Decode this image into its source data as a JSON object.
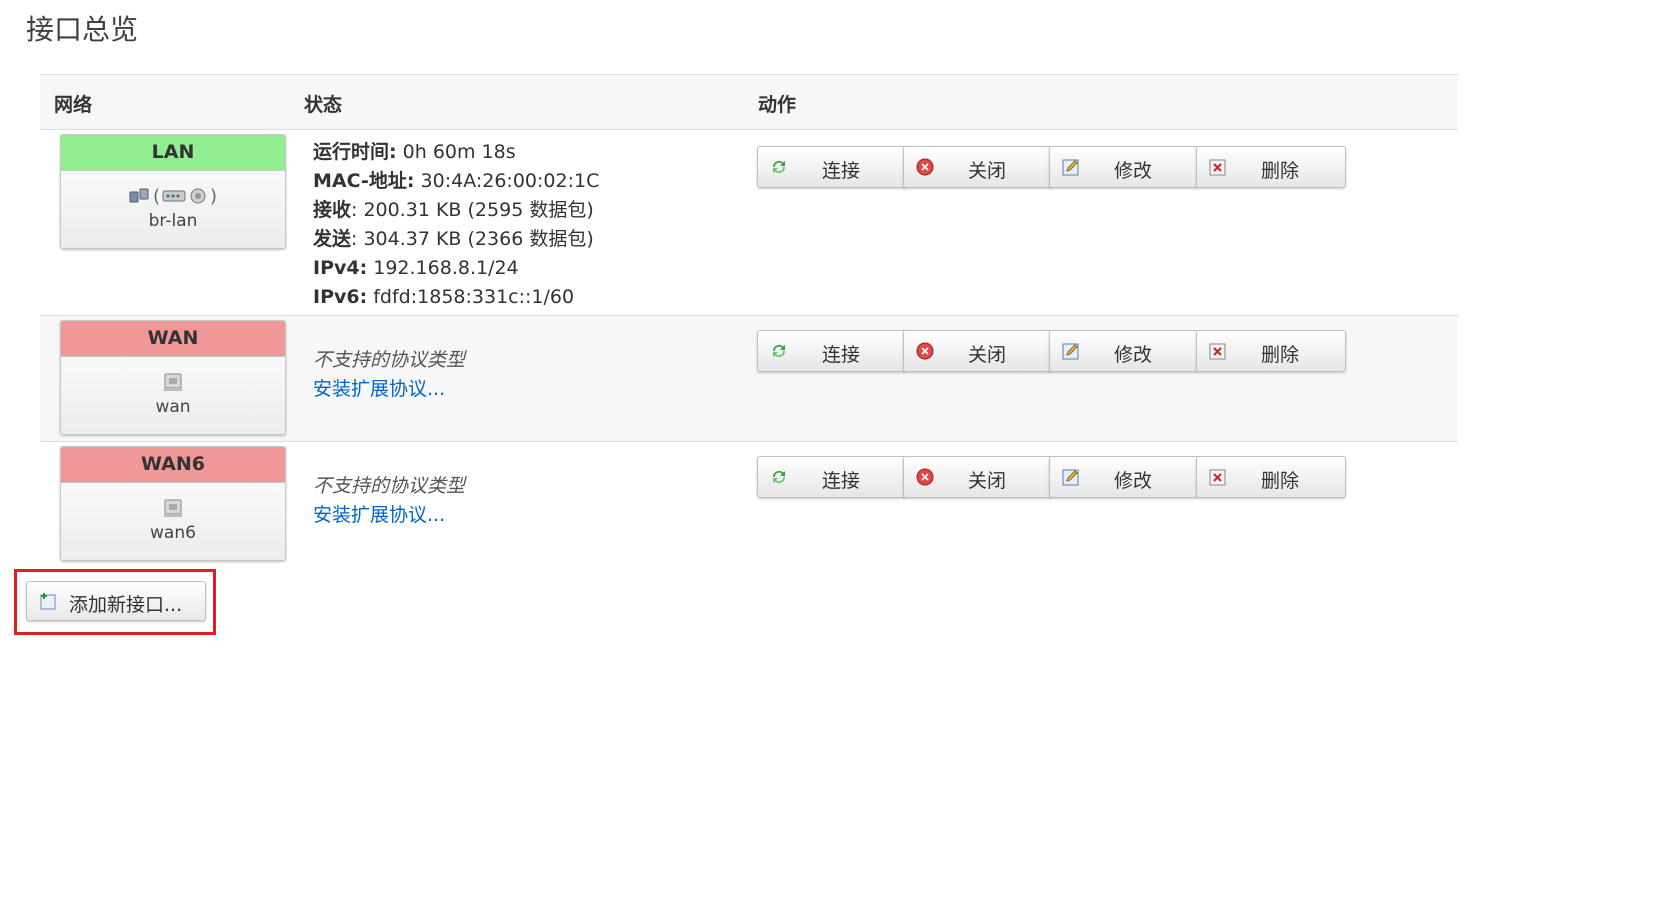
{
  "page": {
    "title": "接口总览"
  },
  "table": {
    "headers": {
      "network": "网络",
      "status": "状态",
      "actions": "动作"
    }
  },
  "buttons": {
    "connect": "连接",
    "stop": "关闭",
    "edit": "修改",
    "delete": "删除"
  },
  "interfaces": [
    {
      "name": "LAN",
      "device": "br-lan",
      "head_color": "#90ee90",
      "status": [
        {
          "label": "运行时间:",
          "value": " 0h 60m 18s"
        },
        {
          "label": "MAC-地址:",
          "value": " 30:4A:26:00:02:1C"
        },
        {
          "label": "接收",
          "value": ": 200.31 KB (2595 数据包)"
        },
        {
          "label": "发送",
          "value": ": 304.37 KB (2366 数据包)"
        },
        {
          "label": "IPv4:",
          "value": " 192.168.8.1/24"
        },
        {
          "label": "IPv6:",
          "value": " fdfd:1858:331c::1/60"
        }
      ]
    },
    {
      "name": "WAN",
      "device": "wan",
      "head_color": "#f09898",
      "unsupported": "不支持的协议类型",
      "install_link": "安装扩展协议..."
    },
    {
      "name": "WAN6",
      "device": "wan6",
      "head_color": "#f09898",
      "unsupported": "不支持的协议类型",
      "install_link": "安装扩展协议..."
    }
  ],
  "add_interface": {
    "label": "添加新接口..."
  }
}
